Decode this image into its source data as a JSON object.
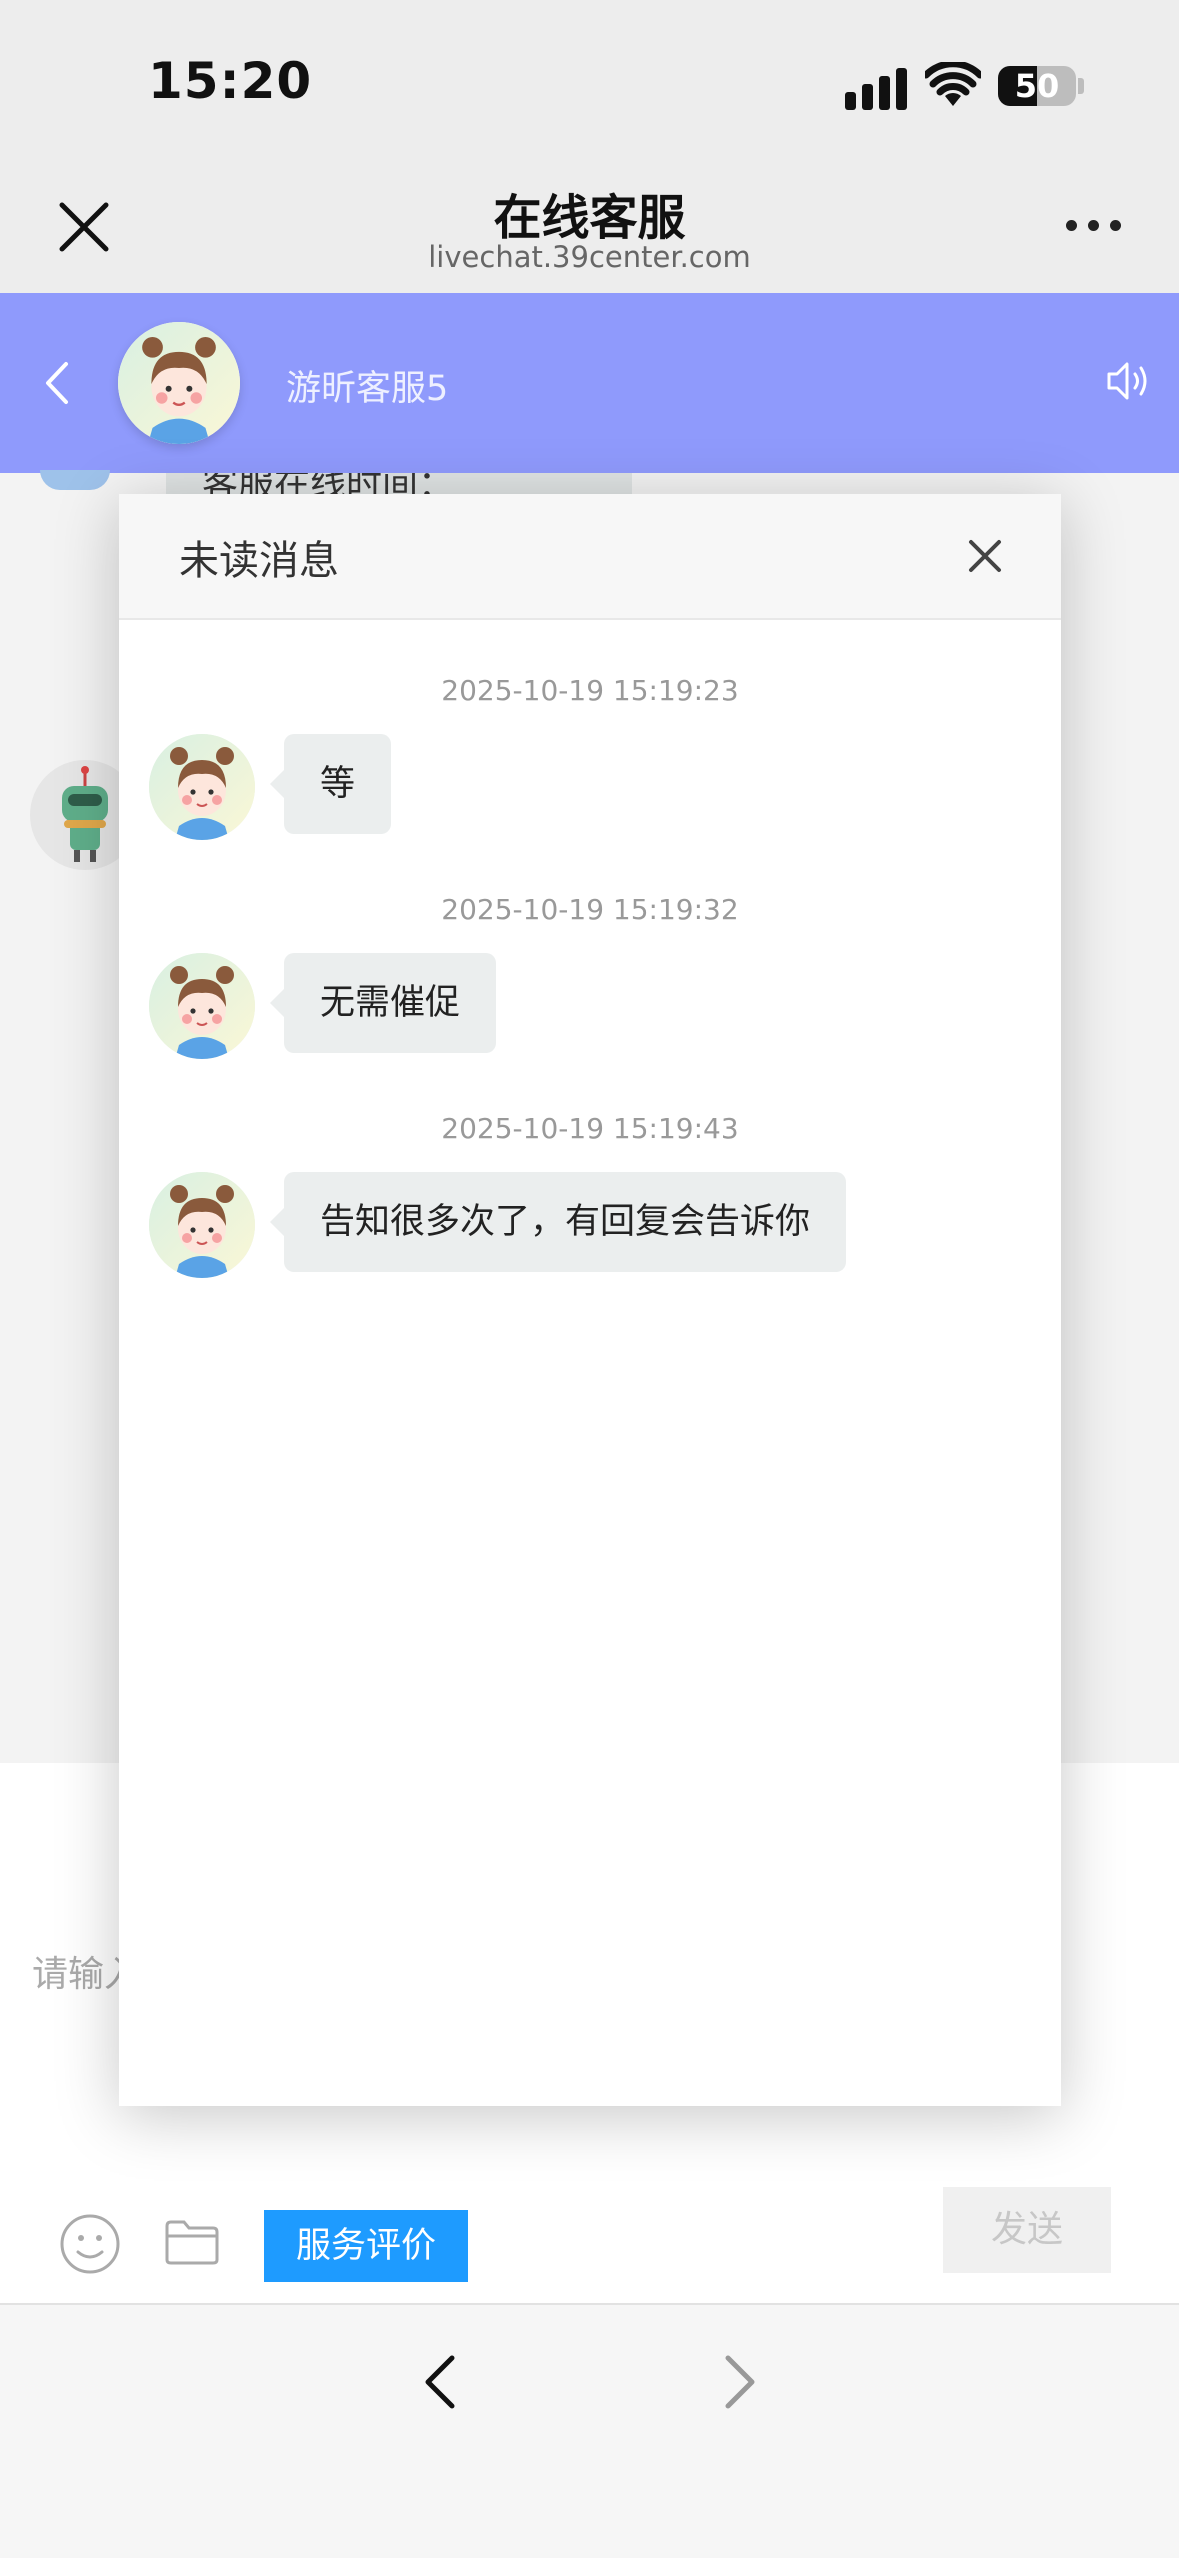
{
  "status_bar": {
    "time": "15:20",
    "battery": "50"
  },
  "browser": {
    "title": "在线客服",
    "url": "livechat.39center.com"
  },
  "chat_header": {
    "agent_name": "游昕客服5"
  },
  "background": {
    "partial_message": "客服在线时间：",
    "input_placeholder": "请输入",
    "rate_button": "服务评价",
    "send_button": "发送"
  },
  "modal": {
    "title": "未读消息",
    "messages": [
      {
        "time": "2025-10-19 15:19:23",
        "text": "等"
      },
      {
        "time": "2025-10-19 15:19:32",
        "text": "无需催促"
      },
      {
        "time": "2025-10-19 15:19:43",
        "text": "告知很多次了，有回复会告诉你"
      }
    ]
  },
  "colors": {
    "chat_header": "#8f9afc",
    "rate_button": "#1e9bff",
    "bubble": "#ebeeee"
  },
  "icons": [
    "close-icon",
    "more-icon",
    "back-arrow-icon",
    "speaker-icon",
    "emoji-icon",
    "folder-icon",
    "chevron-left-icon",
    "chevron-right-icon",
    "robot-avatar-icon",
    "girl-avatar-icon"
  ]
}
